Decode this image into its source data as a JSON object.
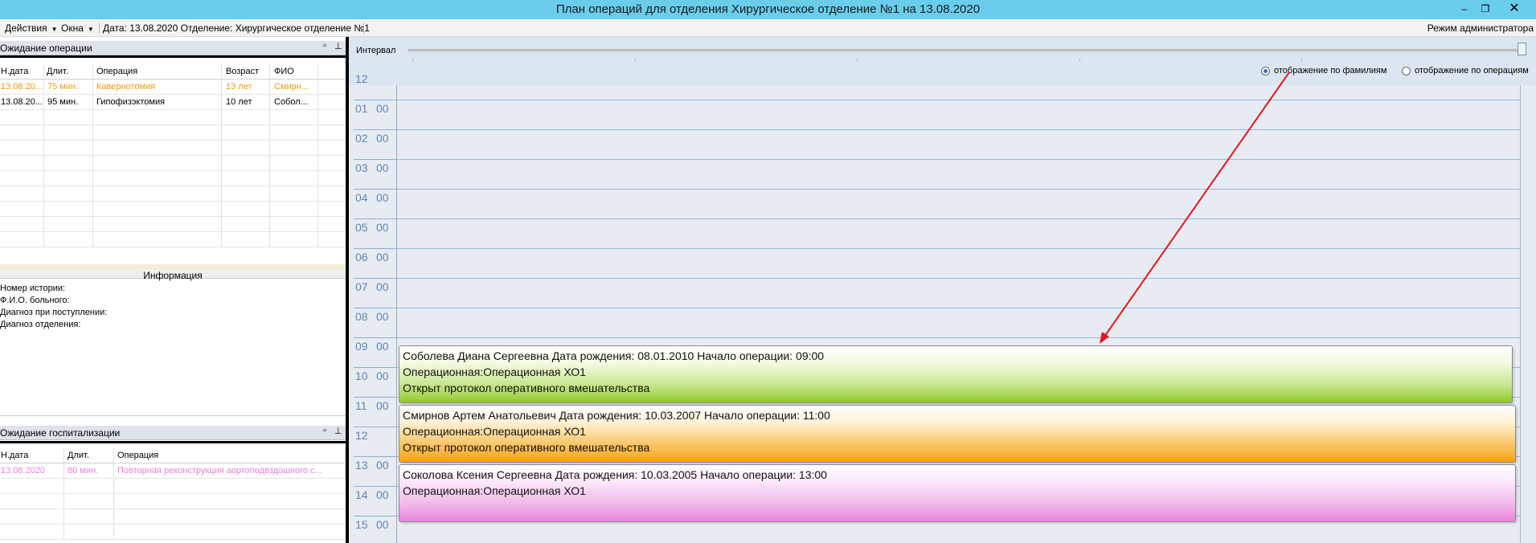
{
  "window": {
    "title": "План операций для отделения Хирургическое отделение №1 на 13.08.2020",
    "min": "–",
    "max": "❐",
    "close": "✕"
  },
  "menu": {
    "actions": "Действия",
    "windows": "Окна",
    "info": "Дата: 13.08.2020 Отделение: Хирургическое отделение №1",
    "admin": "Режим администратора"
  },
  "waiting_surgery": {
    "title": "Ожидание операции",
    "columns": [
      "Н.дата",
      "Длит.",
      "Операция",
      "Возраст",
      "ФИО"
    ],
    "rows": [
      [
        "13.08.20...",
        "75 мин.",
        "Кавернотомия",
        "13 лет",
        "Смирн..."
      ],
      [
        "13.08.20...",
        "95 мин.",
        "Гипофизэктомия",
        "10 лет",
        "Собол..."
      ]
    ]
  },
  "information": {
    "title": "Информация",
    "lines": [
      "Номер истории:",
      "Ф.И.О. больного:",
      "Диагноз при поступлении:",
      "Диагноз отделения:"
    ]
  },
  "waiting_hospitalization": {
    "title": "Ожидание госпитализации",
    "columns": [
      "Н.дата",
      "Длит.",
      "Операция"
    ],
    "rows": [
      [
        "13.08.2020",
        "80 мин.",
        "Повторная реконструкция аортоподвздошного с..."
      ]
    ]
  },
  "schedule": {
    "interval_label": "Интервал",
    "interval_value": 1.0,
    "radio_by_surname": "отображение по фамилиям",
    "radio_by_operation": "отображение по операциям",
    "selected_radio": "by_surname",
    "hours": [
      {
        "h": "12",
        "m": ""
      },
      {
        "h": "01",
        "m": "00"
      },
      {
        "h": "02",
        "m": "00"
      },
      {
        "h": "03",
        "m": "00"
      },
      {
        "h": "04",
        "m": "00"
      },
      {
        "h": "05",
        "m": "00"
      },
      {
        "h": "06",
        "m": "00"
      },
      {
        "h": "07",
        "m": "00"
      },
      {
        "h": "08",
        "m": "00"
      },
      {
        "h": "09",
        "m": "00"
      },
      {
        "h": "10",
        "m": "00"
      },
      {
        "h": "11",
        "m": "00"
      },
      {
        "h": "12",
        "m": ""
      },
      {
        "h": "13",
        "m": "00"
      },
      {
        "h": "14",
        "m": "00"
      },
      {
        "h": "15",
        "m": "00"
      }
    ],
    "operations": [
      {
        "line1": "Соболева Диана Сергеевна Дата рождения: 08.01.2010 Начало операции: 09:00",
        "line2": "Операционная:Операционная ХО1",
        "line3": "Открыт протокол оперативного вмешательства",
        "color": "#8fca2c"
      },
      {
        "line1": "Смирнов Артем Анатольевич Дата рождения: 10.03.2007 Начало операции: 11:00",
        "line2": "Операционная:Операционная ХО1",
        "line3": "Открыт протокол оперативного вмешательства",
        "color": "#f5a40f"
      },
      {
        "line1": "Соколова Ксения Сергеевна Дата рождения: 10.03.2005 Начало операции: 13:00",
        "line2": "Операционная:Операционная ХО1",
        "color": "#ea82dd"
      }
    ]
  },
  "colors": {
    "titlebar": "#6acdec",
    "waiting_row_highlight": "#f39a0e",
    "hospitalization_row": "#ea7fe0",
    "annotation_arrow": "#e8141c"
  }
}
